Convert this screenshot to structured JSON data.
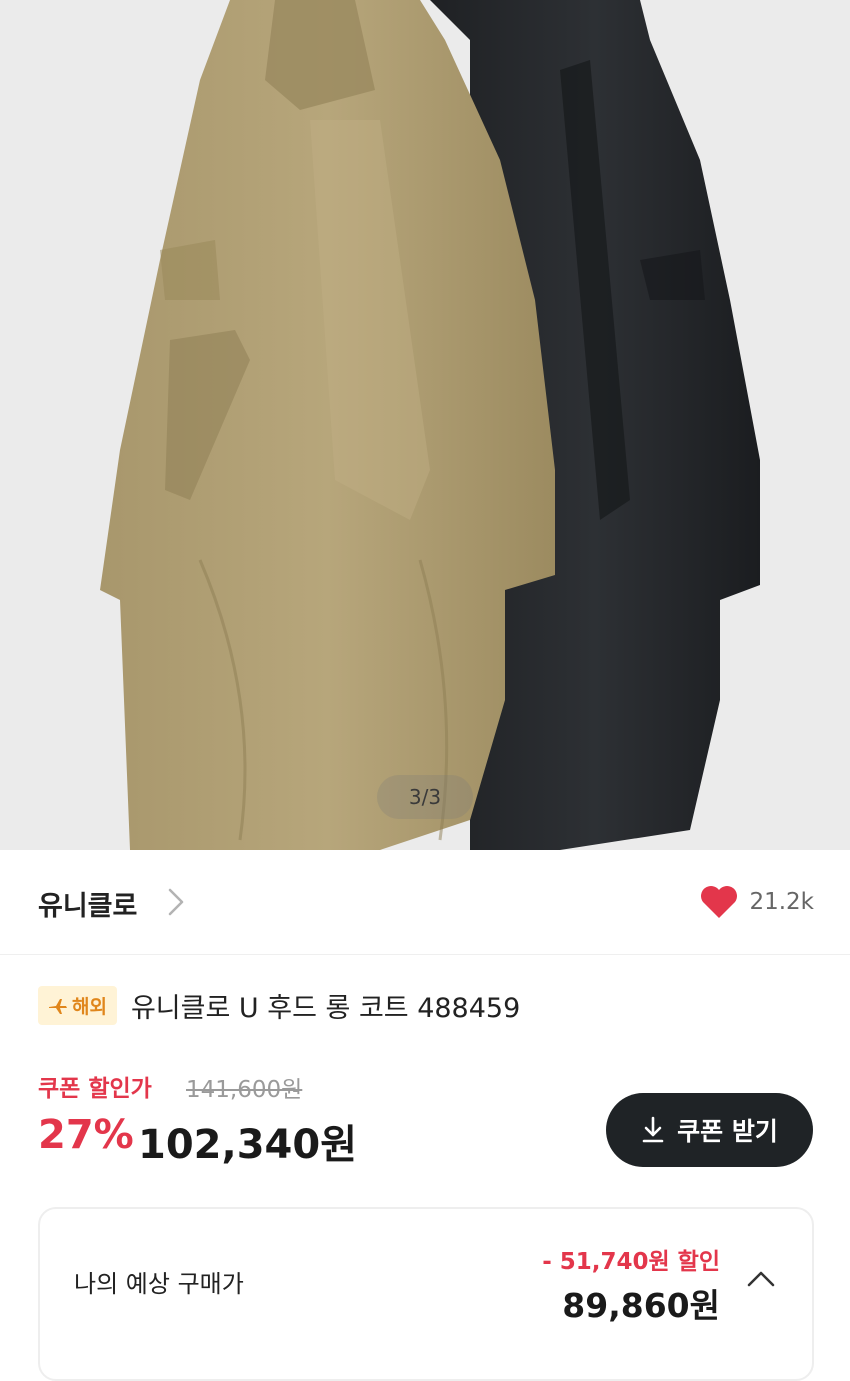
{
  "gallery": {
    "counter": "3/3"
  },
  "brand": {
    "name": "유니클로",
    "likes": "21.2k",
    "like_color": "#e3364b"
  },
  "product": {
    "badge": "해외",
    "badge_icon": "airplane-icon",
    "title": "유니클로 U 후드 롱 코트 488459"
  },
  "pricing": {
    "coupon_label": "쿠폰 할인가",
    "original_price": "141,600원",
    "discount_percent": "27%",
    "price": "102,340원",
    "coupon_button": "쿠폰 받기",
    "accent_color": "#e3364b"
  },
  "estimate": {
    "label": "나의 예상 구매가",
    "discount": "- 51,740원 할인",
    "price": "89,860원"
  }
}
